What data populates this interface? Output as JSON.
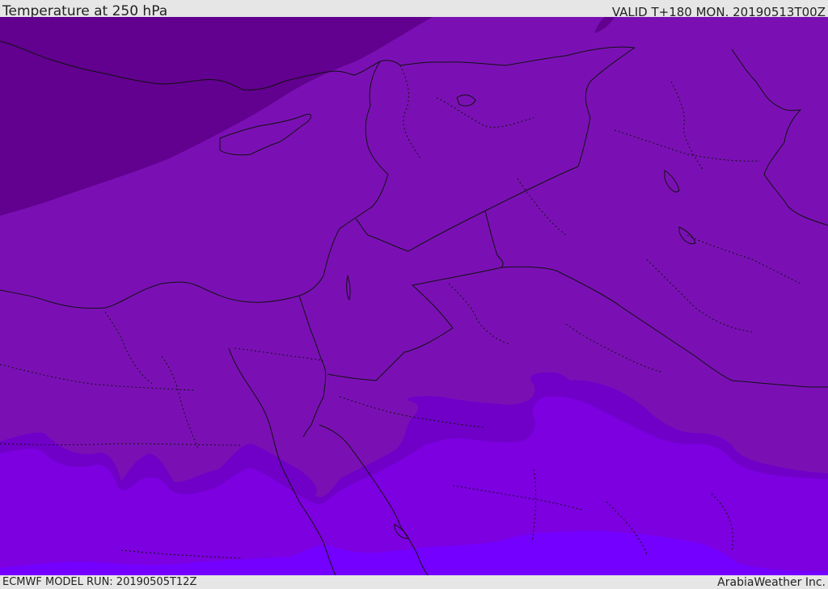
{
  "header": {
    "title": "Temperature at 250 hPa",
    "valid": "VALID T+180 MON. 20190513T00Z"
  },
  "footer": {
    "model_run": "ECMWF MODEL RUN: 20190505T12Z",
    "credit": "ArabiaWeather Inc."
  },
  "colors": {
    "band_coldest": "#62008f",
    "band_cold": "#7a10b4",
    "band_mid": "#7000c8",
    "band_warm": "#7c00e0",
    "band_warmest": "#7400ff",
    "border": "#111111",
    "frame": "#e6e6e6"
  }
}
